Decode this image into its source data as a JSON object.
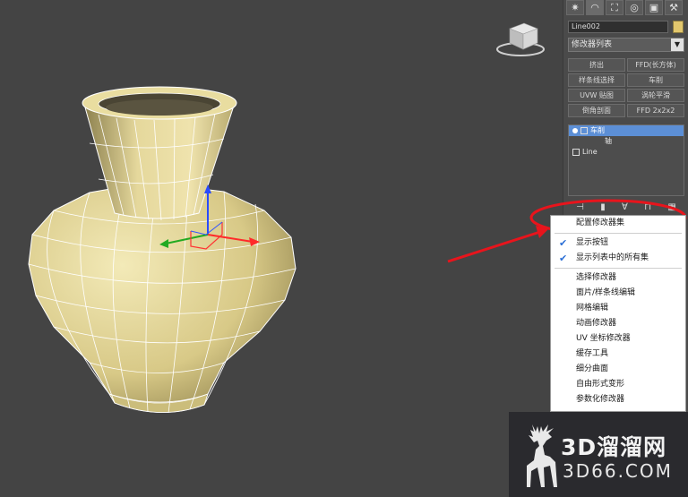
{
  "viewport": {
    "label": "Perspective viewport",
    "object_color": "#e6d99a",
    "wire_color": "#ffffff"
  },
  "command_panel": {
    "tabs": [
      {
        "icon": "sun-create-icon",
        "glyph": "✷"
      },
      {
        "icon": "modify-icon",
        "glyph": "◠"
      },
      {
        "icon": "hierarchy-icon",
        "glyph": "⛶"
      },
      {
        "icon": "motion-icon",
        "glyph": "◎"
      },
      {
        "icon": "display-icon",
        "glyph": "▣"
      },
      {
        "icon": "utilities-icon",
        "glyph": "⚒"
      }
    ],
    "object_name": "Line002",
    "object_color": "#e2c76d",
    "modifier_list": "修改器列表",
    "modifier_buttons": [
      "挤出",
      "FFD(长方体)",
      "样条线选择",
      "车削",
      "UVW 贴图",
      "涡轮平滑",
      "倒角剖面",
      "FFD 2x2x2"
    ],
    "stack": [
      {
        "label": "车削",
        "selected": true
      },
      {
        "label": "轴",
        "selected": false,
        "sub": true
      },
      {
        "label": "Line",
        "selected": false
      }
    ]
  },
  "context_menu": {
    "items": [
      {
        "label": "配置修改器集",
        "checked": false
      },
      {
        "separator": true
      },
      {
        "label": "显示按钮",
        "checked": true
      },
      {
        "label": "显示列表中的所有集",
        "checked": true
      },
      {
        "separator": true
      },
      {
        "label": "选择修改器",
        "checked": false
      },
      {
        "label": "面片/样条线编辑",
        "checked": false
      },
      {
        "label": "网格编辑",
        "checked": false
      },
      {
        "label": "动画修改器",
        "checked": false
      },
      {
        "label": "UV 坐标修改器",
        "checked": false
      },
      {
        "label": "缓存工具",
        "checked": false
      },
      {
        "label": "细分曲面",
        "checked": false
      },
      {
        "label": "自由形式变形",
        "checked": false
      },
      {
        "label": "参数化修改器",
        "checked": false
      }
    ]
  },
  "watermark": {
    "line1": "3D溜溜网",
    "line2": "3D66.COM"
  },
  "annotation_color": "#e8141c"
}
